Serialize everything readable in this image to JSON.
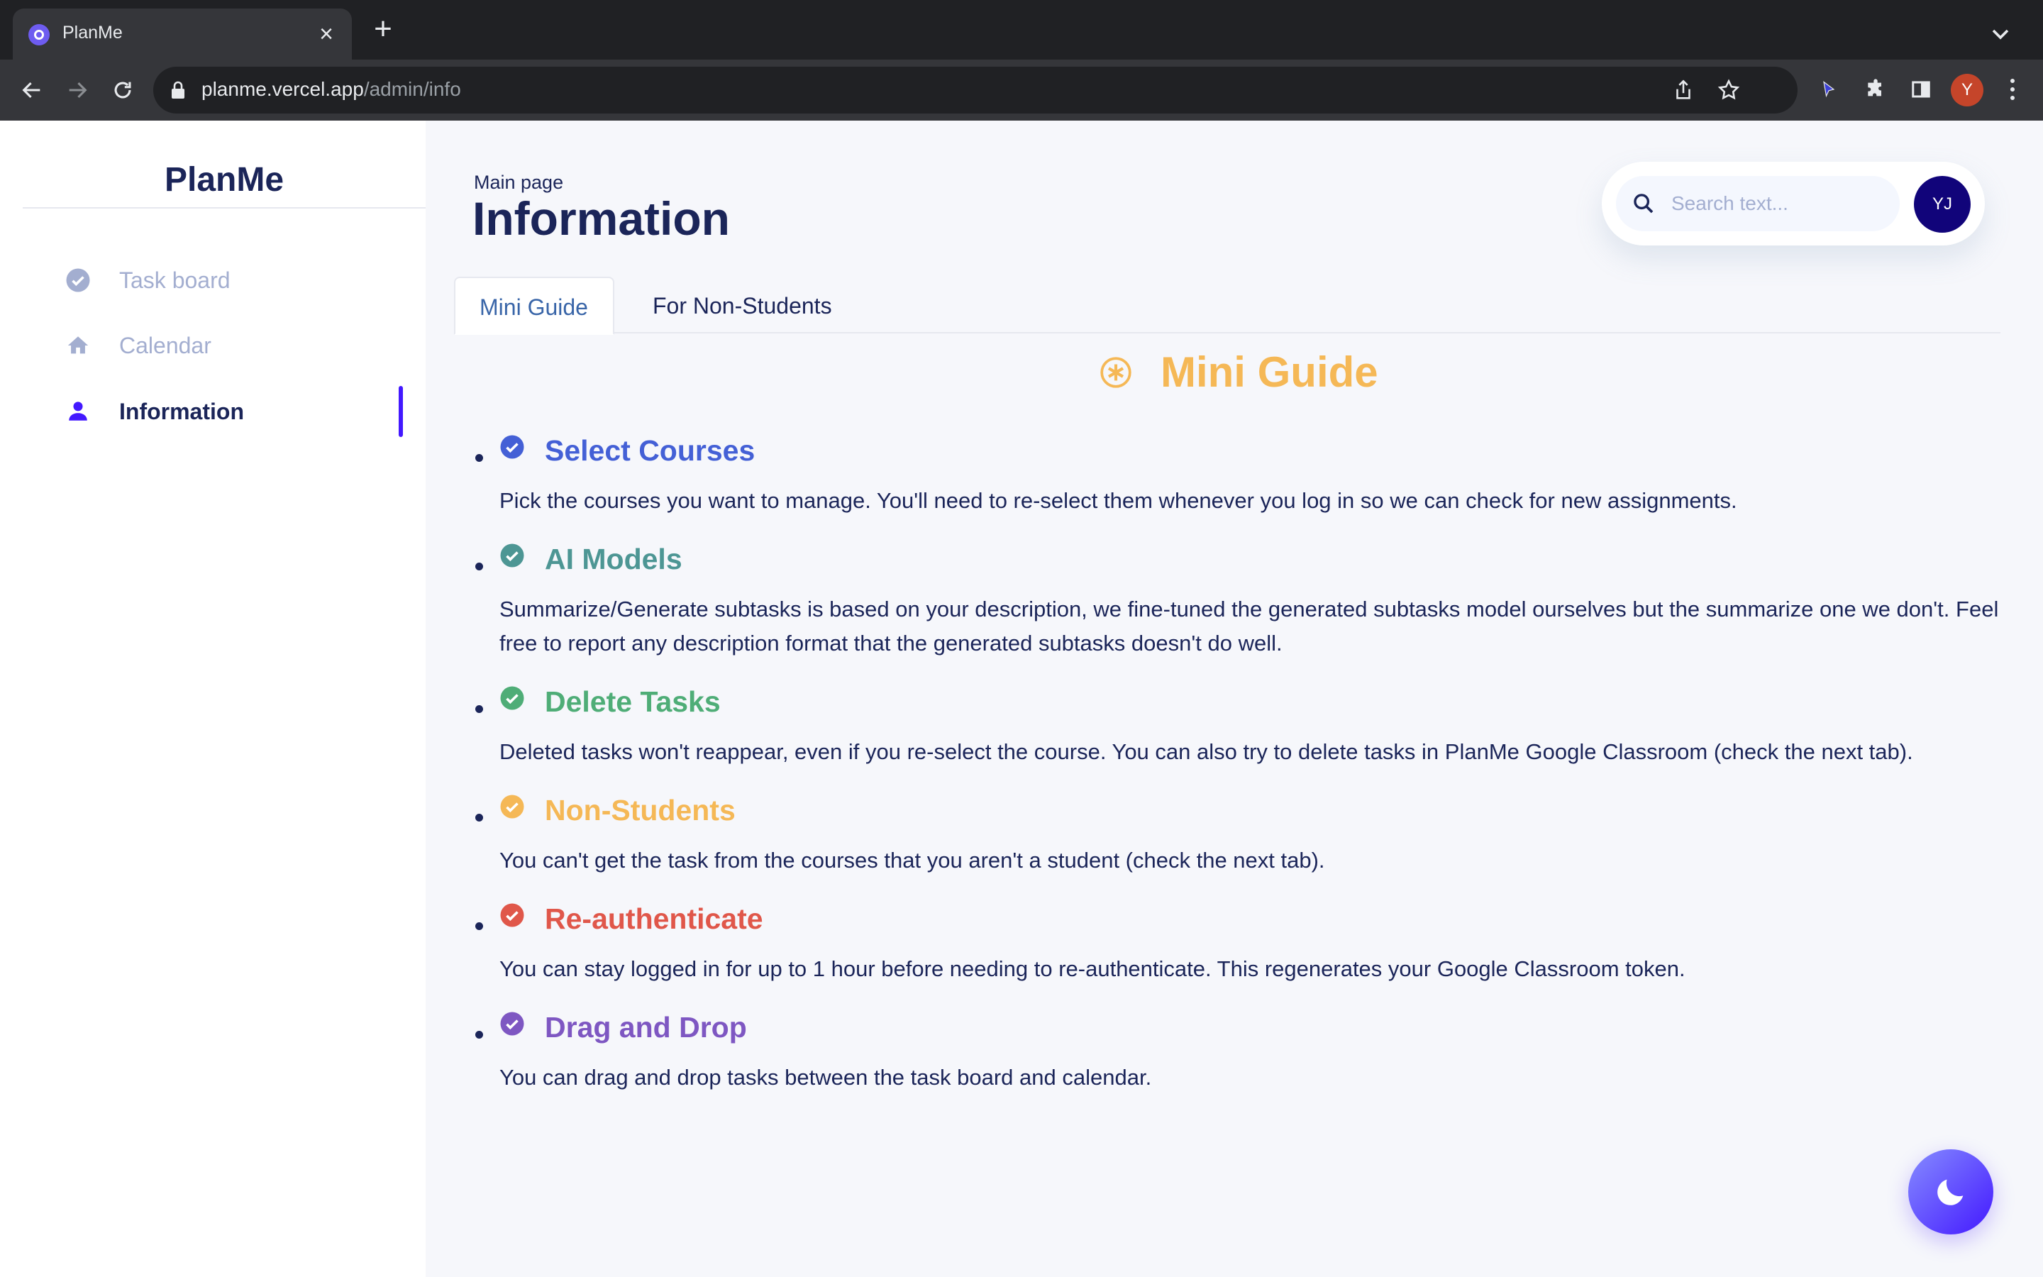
{
  "browser": {
    "tab_title": "PlanMe",
    "tab_close": "×",
    "new_tab": "+",
    "url_host": "planme.vercel.app",
    "url_path": "/admin/info",
    "profile_initial": "Y"
  },
  "sidebar": {
    "brand": "PlanMe",
    "items": [
      {
        "label": "Task board",
        "icon": "check-circle-icon"
      },
      {
        "label": "Calendar",
        "icon": "home-icon"
      },
      {
        "label": "Information",
        "icon": "person-icon",
        "active": true
      }
    ]
  },
  "header": {
    "breadcrumb": "Main page",
    "title": "Information",
    "search_placeholder": "Search text...",
    "avatar_initials": "YJ"
  },
  "tabs": [
    {
      "label": "Mini Guide",
      "active": true
    },
    {
      "label": "For Non-Students"
    }
  ],
  "guide": {
    "title": "Mini Guide",
    "items": [
      {
        "title": "Select Courses",
        "color": "#4460d6",
        "text": "Pick the courses you want to manage. You'll need to re-select them whenever you log in so we can check for new assignments."
      },
      {
        "title": "AI Models",
        "color": "#4d9694",
        "text": "Summarize/Generate subtasks is based on your description, we fine-tuned the generated subtasks model ourselves but the summarize one we don't. Feel free to report any description format that the generated subtasks doesn't do well."
      },
      {
        "title": "Delete Tasks",
        "color": "#4fad77",
        "text": "Deleted tasks won't reappear, even if you re-select the course. You can also try to delete tasks in PlanMe Google Classroom (check the next tab)."
      },
      {
        "title": "Non-Students",
        "color": "#f5b856",
        "text": "You can't get the task from the courses that you aren't a student (check the next tab)."
      },
      {
        "title": "Re-authenticate",
        "color": "#e0574a",
        "text": "You can stay logged in for up to 1 hour before needing to re-authenticate. This regenerates your Google Classroom token."
      },
      {
        "title": "Drag and Drop",
        "color": "#7e57c2",
        "text": "You can drag and drop tasks between the task board and calendar."
      }
    ]
  },
  "colors": {
    "accent": "#4318ff",
    "navy": "#1b2559",
    "muted": "#a3aed0",
    "guide_title": "#f5b856"
  }
}
